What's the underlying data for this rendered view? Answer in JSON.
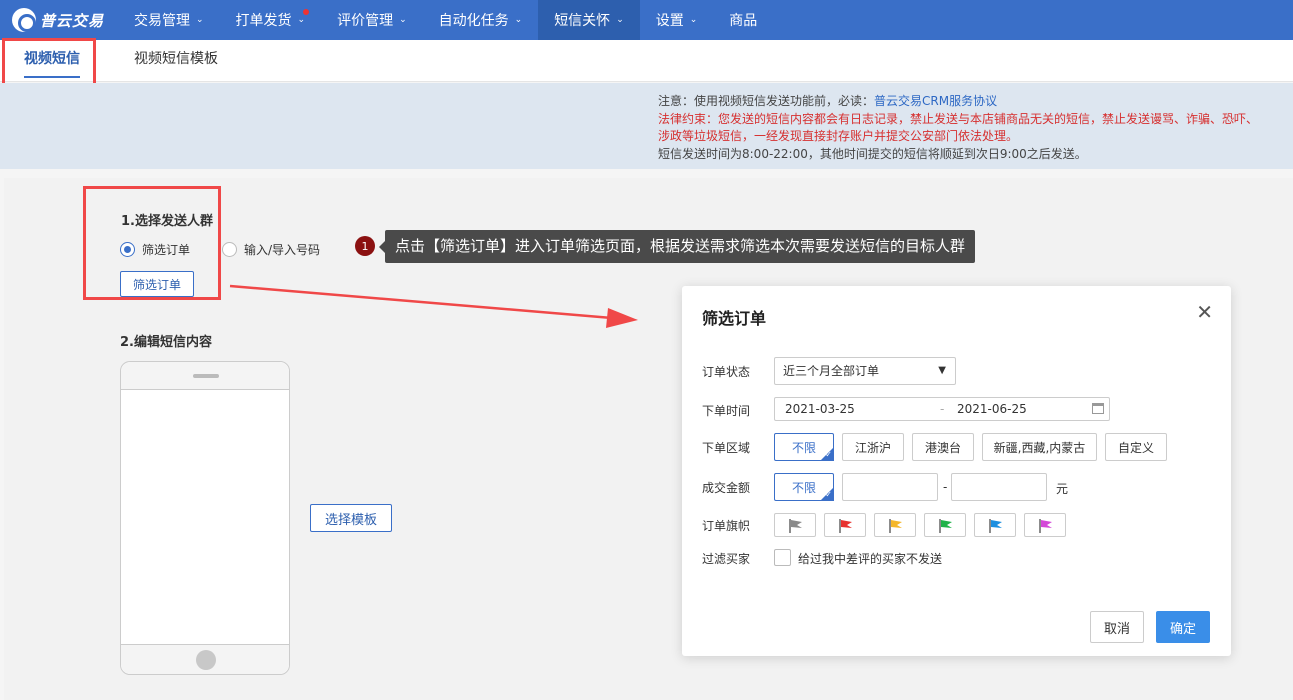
{
  "app": {
    "logo_text": "普云交易"
  },
  "nav": {
    "items": [
      {
        "label": "交易管理",
        "has_dropdown": true
      },
      {
        "label": "打单发货",
        "has_dropdown": true,
        "badge": true
      },
      {
        "label": "评价管理",
        "has_dropdown": true
      },
      {
        "label": "自动化任务",
        "has_dropdown": true
      },
      {
        "label": "短信关怀",
        "has_dropdown": true,
        "active": true
      },
      {
        "label": "设置",
        "has_dropdown": true
      },
      {
        "label": "商品",
        "has_dropdown": false
      }
    ],
    "chevron": "⌄"
  },
  "subtabs": {
    "tab1": "视频短信",
    "tab2": "视频短信模板"
  },
  "notice": {
    "line1_prefix": "注意：使用视频短信发送功能前，必读：",
    "line1_link": "普云交易CRM服务协议",
    "line2": "法律约束：您发送的短信内容都会有日志记录，禁止发送与本店铺商品无关的短信，禁止发送谩骂、诈骗、恐吓、涉政等垃圾短信，一经发现直接封存账户并提交公安部门依法处理。",
    "line3": "短信发送时间为8:00-22:00，其他时间提交的短信将顺延到次日9:00之后发送。"
  },
  "section1": {
    "title": "1.选择发送人群",
    "radio1": "筛选订单",
    "radio2": "输入/导入号码",
    "filter_button": "筛选订单"
  },
  "section2": {
    "title": "2.编辑短信内容",
    "template_button": "选择模板"
  },
  "tooltip": {
    "step": "1",
    "text": "点击【筛选订单】进入订单筛选页面，根据发送需求筛选本次需要发送短信的目标人群"
  },
  "modal": {
    "title": "筛选订单",
    "close": "✕",
    "order_status_label": "订单状态",
    "order_status_value": "近三个月全部订单",
    "order_time_label": "下单时间",
    "date_start": "2021-03-25",
    "date_sep": "-",
    "date_end": "2021-06-25",
    "region_label": "下单区域",
    "regions": [
      "不限",
      "江浙沪",
      "港澳台",
      "新疆,西藏,内蒙古",
      "自定义"
    ],
    "amount_label": "成交金额",
    "amount_any": "不限",
    "amount_sep": "-",
    "amount_unit": "元",
    "flag_label": "订单旗帜",
    "flag_colors": [
      "#8a8a8a",
      "#e8322f",
      "#f5b72a",
      "#21b34a",
      "#1d8fe0",
      "#d448d8"
    ],
    "filter_label": "过滤买家",
    "filter_checkbox_text": "给过我中差评的买家不发送",
    "cancel": "取消",
    "ok": "确定"
  }
}
